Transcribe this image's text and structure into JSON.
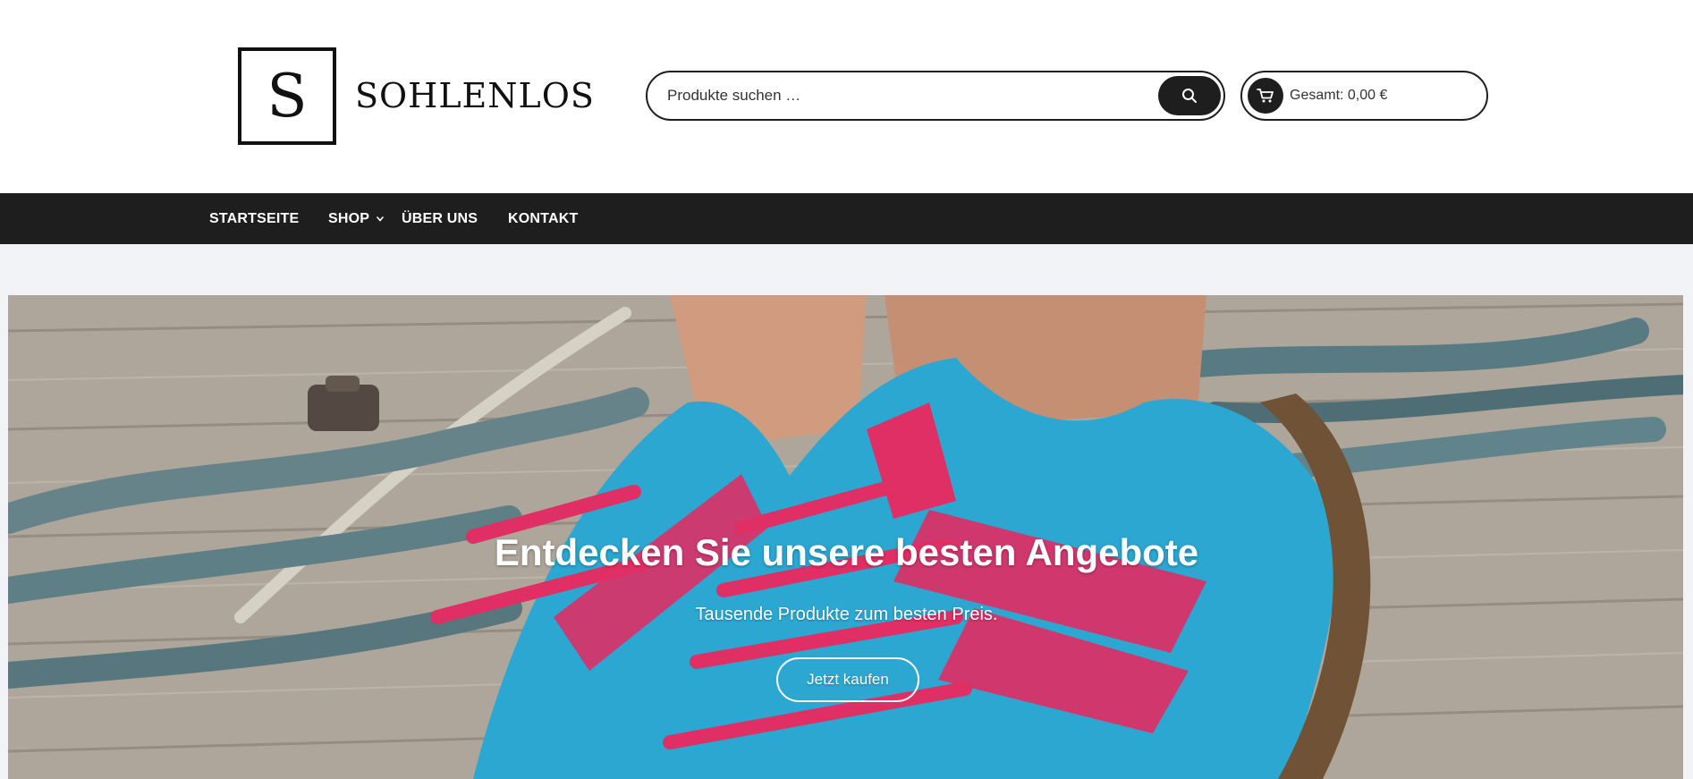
{
  "header": {
    "logo_letter": "S",
    "logo_text": "SOHLENLOS",
    "search": {
      "placeholder": "Produkte suchen …",
      "button_icon": "search-icon"
    },
    "cart": {
      "icon": "cart-icon",
      "total": "Gesamt: 0,00 €"
    }
  },
  "nav": {
    "items": [
      {
        "label": "STARTSEITE"
      },
      {
        "label": "SHOP",
        "icon": "chevron-down-icon"
      },
      {
        "label": "ÜBER UNS"
      },
      {
        "label": "KONTAKT"
      }
    ]
  },
  "hero": {
    "title": "Entdecken Sie unsere besten Angebote",
    "subtitle": "Tausende Produkte zum besten Preis.",
    "cta_label": "Jetzt kaufen"
  },
  "colors": {
    "dark": "#1e1e1e",
    "page_bg": "#f2f3f7",
    "shoe_blue": "#2fb6e3",
    "shoe_pink": "#f2336e"
  }
}
